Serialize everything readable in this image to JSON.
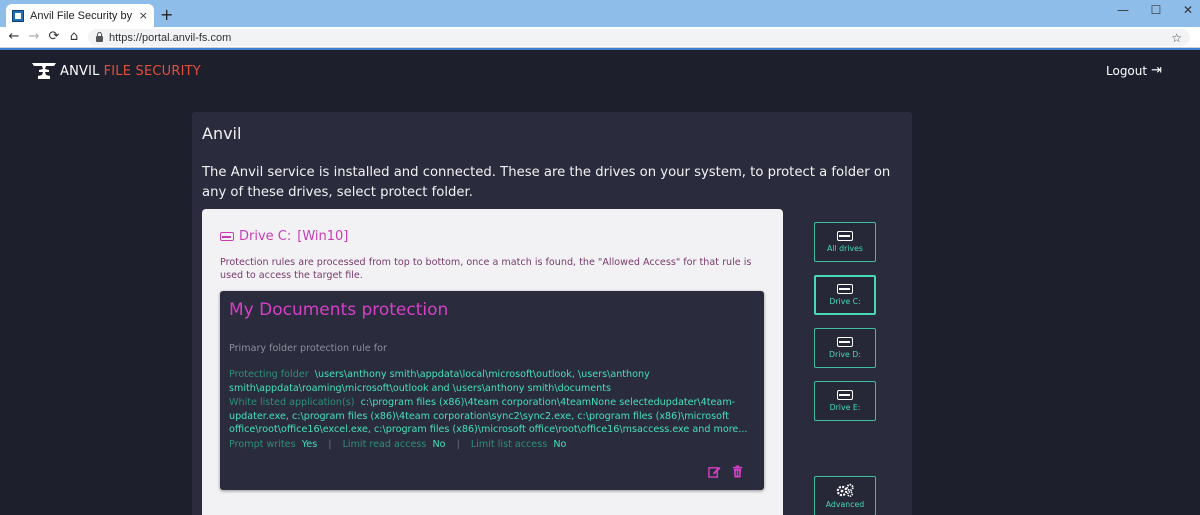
{
  "browser": {
    "tab_title": "Anvil File Security by Division-M",
    "tab_close": "×",
    "new_tab": "+",
    "window_minimize": "—",
    "window_maximize": "☐",
    "window_close": "✕",
    "nav_back": "←",
    "nav_forward": "→",
    "nav_reload": "⟳",
    "nav_home": "⌂",
    "url": "https://portal.anvil-fs.com",
    "bookmark_star": "☆"
  },
  "header": {
    "brand_main": "ANVIL",
    "brand_accent": "FILE SECURITY",
    "logout_label": "Logout",
    "logout_icon": "⇥"
  },
  "panel": {
    "title": "Anvil",
    "intro": "The Anvil service is installed and connected. These are the drives on your system, to protect a folder on any of these drives, select protect folder."
  },
  "drive": {
    "name": "Drive C:",
    "label": "[Win10]",
    "rules_note": "Protection rules are processed from top to bottom, once a match is found, the \"Allowed Access\" for that rule is used to access the target file."
  },
  "rule": {
    "title": "My Documents protection",
    "subtitle": "Primary folder protection rule for",
    "protecting_label": "Protecting folder",
    "protecting_value": "\\users\\anthony smith\\appdata\\local\\microsoft\\outlook, \\users\\anthony smith\\appdata\\roaming\\microsoft\\outlook and \\users\\anthony smith\\documents",
    "whitelist_label": "White listed application(s)",
    "whitelist_value": "c:\\program files (x86)\\4team corporation\\4teamNone selectedupdater\\4team-updater.exe, c:\\program files (x86)\\4team corporation\\sync2\\sync2.exe, c:\\program files (x86)\\microsoft office\\root\\office16\\excel.exe, c:\\program files (x86)\\microsoft office\\root\\office16\\msaccess.exe and more...",
    "prompt_writes_label": "Prompt writes",
    "prompt_writes_value": "Yes",
    "limit_read_label": "Limit read access",
    "limit_read_value": "No",
    "limit_list_label": "Limit list access",
    "limit_list_value": "No",
    "separator": "|"
  },
  "sidebar": {
    "items": [
      {
        "label": "All drives"
      },
      {
        "label": "Drive C:"
      },
      {
        "label": "Drive D:"
      },
      {
        "label": "Drive E:"
      },
      {
        "label": "Advanced"
      }
    ]
  },
  "colors": {
    "page_bg": "#1e1f2c",
    "panel_bg": "#2a2c3d",
    "accent_teal": "#47d9b5",
    "accent_magenta": "#d63fc7",
    "brand_red": "#e2503a"
  }
}
